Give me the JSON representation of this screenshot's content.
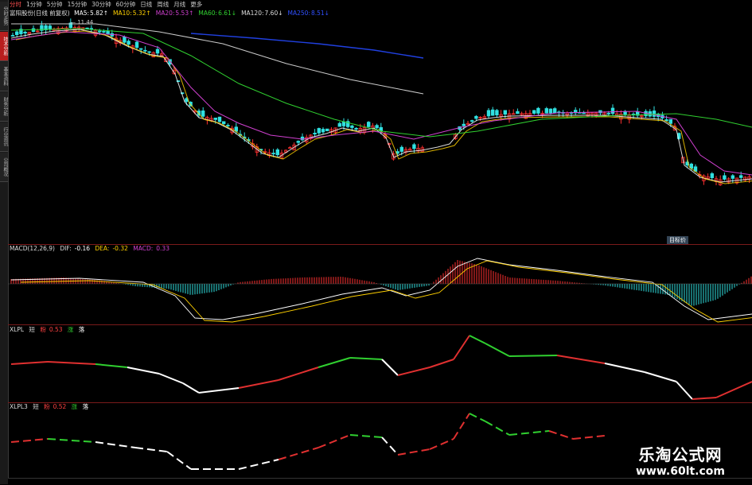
{
  "sidebar": {
    "tabs": [
      {
        "label": "分时走势",
        "active": false
      },
      {
        "label": "技术分析",
        "active": true
      },
      {
        "label": "基本资料",
        "active": false
      },
      {
        "label": "财务分析",
        "active": false
      },
      {
        "label": "行业资讯",
        "active": false
      },
      {
        "label": "公司概况",
        "active": false
      }
    ]
  },
  "periods": [
    "分时",
    "1分钟",
    "5分钟",
    "15分钟",
    "30分钟",
    "60分钟",
    "日线",
    "周线",
    "月线",
    "更多"
  ],
  "active_period": "分时",
  "ma": {
    "title": "富阳股份(日线 前复权)",
    "items": [
      {
        "label": "MA5:",
        "value": "5.82",
        "arrow": "↑",
        "color": "#ffffff"
      },
      {
        "label": "MA10:",
        "value": "5.32",
        "arrow": "↑",
        "color": "#ffd000"
      },
      {
        "label": "MA20:",
        "value": "5.53",
        "arrow": "↑",
        "color": "#d040d0"
      },
      {
        "label": "MA60:",
        "value": "6.61",
        "arrow": "↓",
        "color": "#30d030"
      },
      {
        "label": "MA120:",
        "value": "7.60",
        "arrow": "↓",
        "color": "#dddddd"
      },
      {
        "label": "MA250:",
        "value": "8.51",
        "arrow": "↓",
        "color": "#3050ff"
      }
    ],
    "high_marker": "11.44"
  },
  "macd": {
    "label": "MACD(12,26,9)",
    "dif_label": "DIF:",
    "dif": "-0.16",
    "dea_label": "DEA:",
    "dea": "-0.32",
    "macd_label": "MACD:",
    "macd": "0.33"
  },
  "xlpl": {
    "name": "XLPL",
    "a": "短",
    "b": "粉",
    "b_val": "0.53",
    "c": "涨",
    "d": "落"
  },
  "xlpl3": {
    "name": "XLPL3",
    "a": "短",
    "b": "粉",
    "b_val": "0.52",
    "c": "涨",
    "d": "落"
  },
  "badge": "目标价",
  "watermark": {
    "title": "乐淘公式网",
    "url": "www.60lt.com"
  },
  "colors": {
    "up": "#ff3030",
    "down": "#30e0e0",
    "ma5": "#ffffff",
    "ma10": "#ffd000",
    "ma20": "#d040d0",
    "ma60": "#30d030",
    "ma250": "#2040e0",
    "xl_red": "#e03030",
    "xl_green": "#30d030",
    "xl_white": "#ffffff"
  }
}
